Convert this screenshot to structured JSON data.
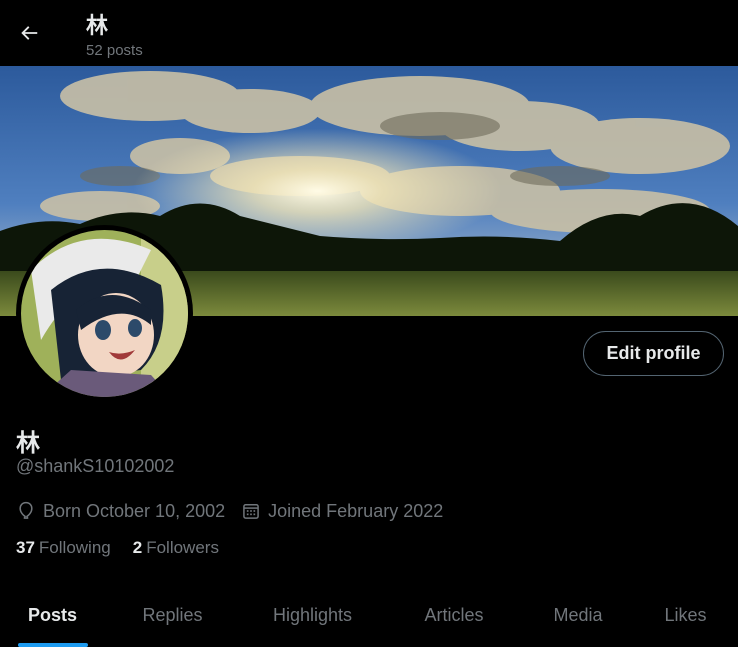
{
  "header": {
    "name": "林",
    "post_count": "52 posts",
    "back_icon": "arrow-left-icon"
  },
  "profile": {
    "display_name": "林",
    "handle": "@shankS10102002",
    "edit_button": "Edit profile",
    "born": "Born October 10, 2002",
    "joined": "Joined February 2022",
    "born_icon": "balloon-icon",
    "joined_icon": "calendar-icon",
    "following_count": "37",
    "following_label": "Following",
    "followers_count": "2",
    "followers_label": "Followers"
  },
  "tabs": [
    {
      "label": "Posts",
      "active": true
    },
    {
      "label": "Replies",
      "active": false
    },
    {
      "label": "Highlights",
      "active": false
    },
    {
      "label": "Articles",
      "active": false
    },
    {
      "label": "Media",
      "active": false
    },
    {
      "label": "Likes",
      "active": false
    }
  ],
  "colors": {
    "background": "#000000",
    "text_primary": "#e7e9ea",
    "text_secondary": "#71767b",
    "accent": "#1d9bf0",
    "border": "#536471"
  }
}
